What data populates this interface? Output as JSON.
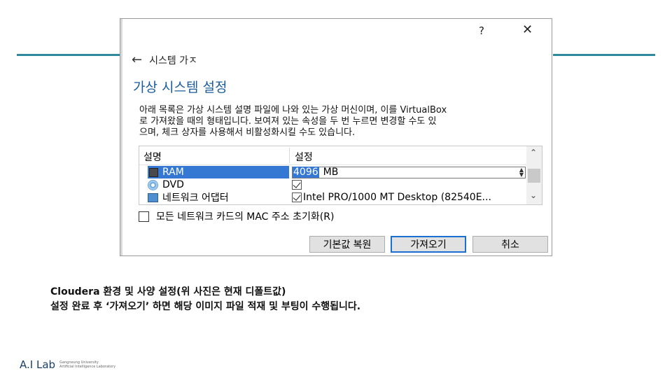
{
  "dialog": {
    "help_label": "?",
    "close_label": "✕",
    "breadcrumb": "시스템 가ㅈ",
    "title": "가상 시스템 설정",
    "description_lines": [
      "아래 목록은 가상 시스템 설명 파일에 나와 있는 가상 머신이며, 이를 VirtualBox",
      "로 가져왔을 때의 형태입니다. 보여져 있는 속성을 두 번 누르면 변경할 수도 있",
      "으며, 체크 상자를 사용해서 비활성화시킬 수도 있습니다."
    ],
    "table": {
      "col_name": "설명",
      "col_value": "설정",
      "rows": [
        {
          "name": "RAM",
          "value_num": "4096",
          "value_unit": "MB"
        },
        {
          "name": "DVD"
        },
        {
          "name": "네트워크 어댑터",
          "value": "Intel PRO/1000 MT Desktop (82540E..."
        }
      ]
    },
    "mac_reset_label": "모든 네트워크 카드의 MAC 주소 초기화(R)",
    "buttons": {
      "reset": "기본값 복원",
      "import": "가져오기",
      "cancel": "취소"
    }
  },
  "caption": {
    "line1": "Cloudera 환경 및 사양 설정(위 사진은 현재 디폴트값)",
    "line2": "설정 완료 후 ‘가져오기’ 하면 해당 이미지 파일 적재 및 부팅이 수행됩니다."
  },
  "logo": {
    "main": "A.I Lab",
    "sub1": "Gangneung University",
    "sub2": "Artificial Intelligence Laboratory"
  },
  "colors": {
    "accent_line": "#2f8a9e",
    "title_blue": "#1a5c9a",
    "selection": "#3478d4"
  }
}
